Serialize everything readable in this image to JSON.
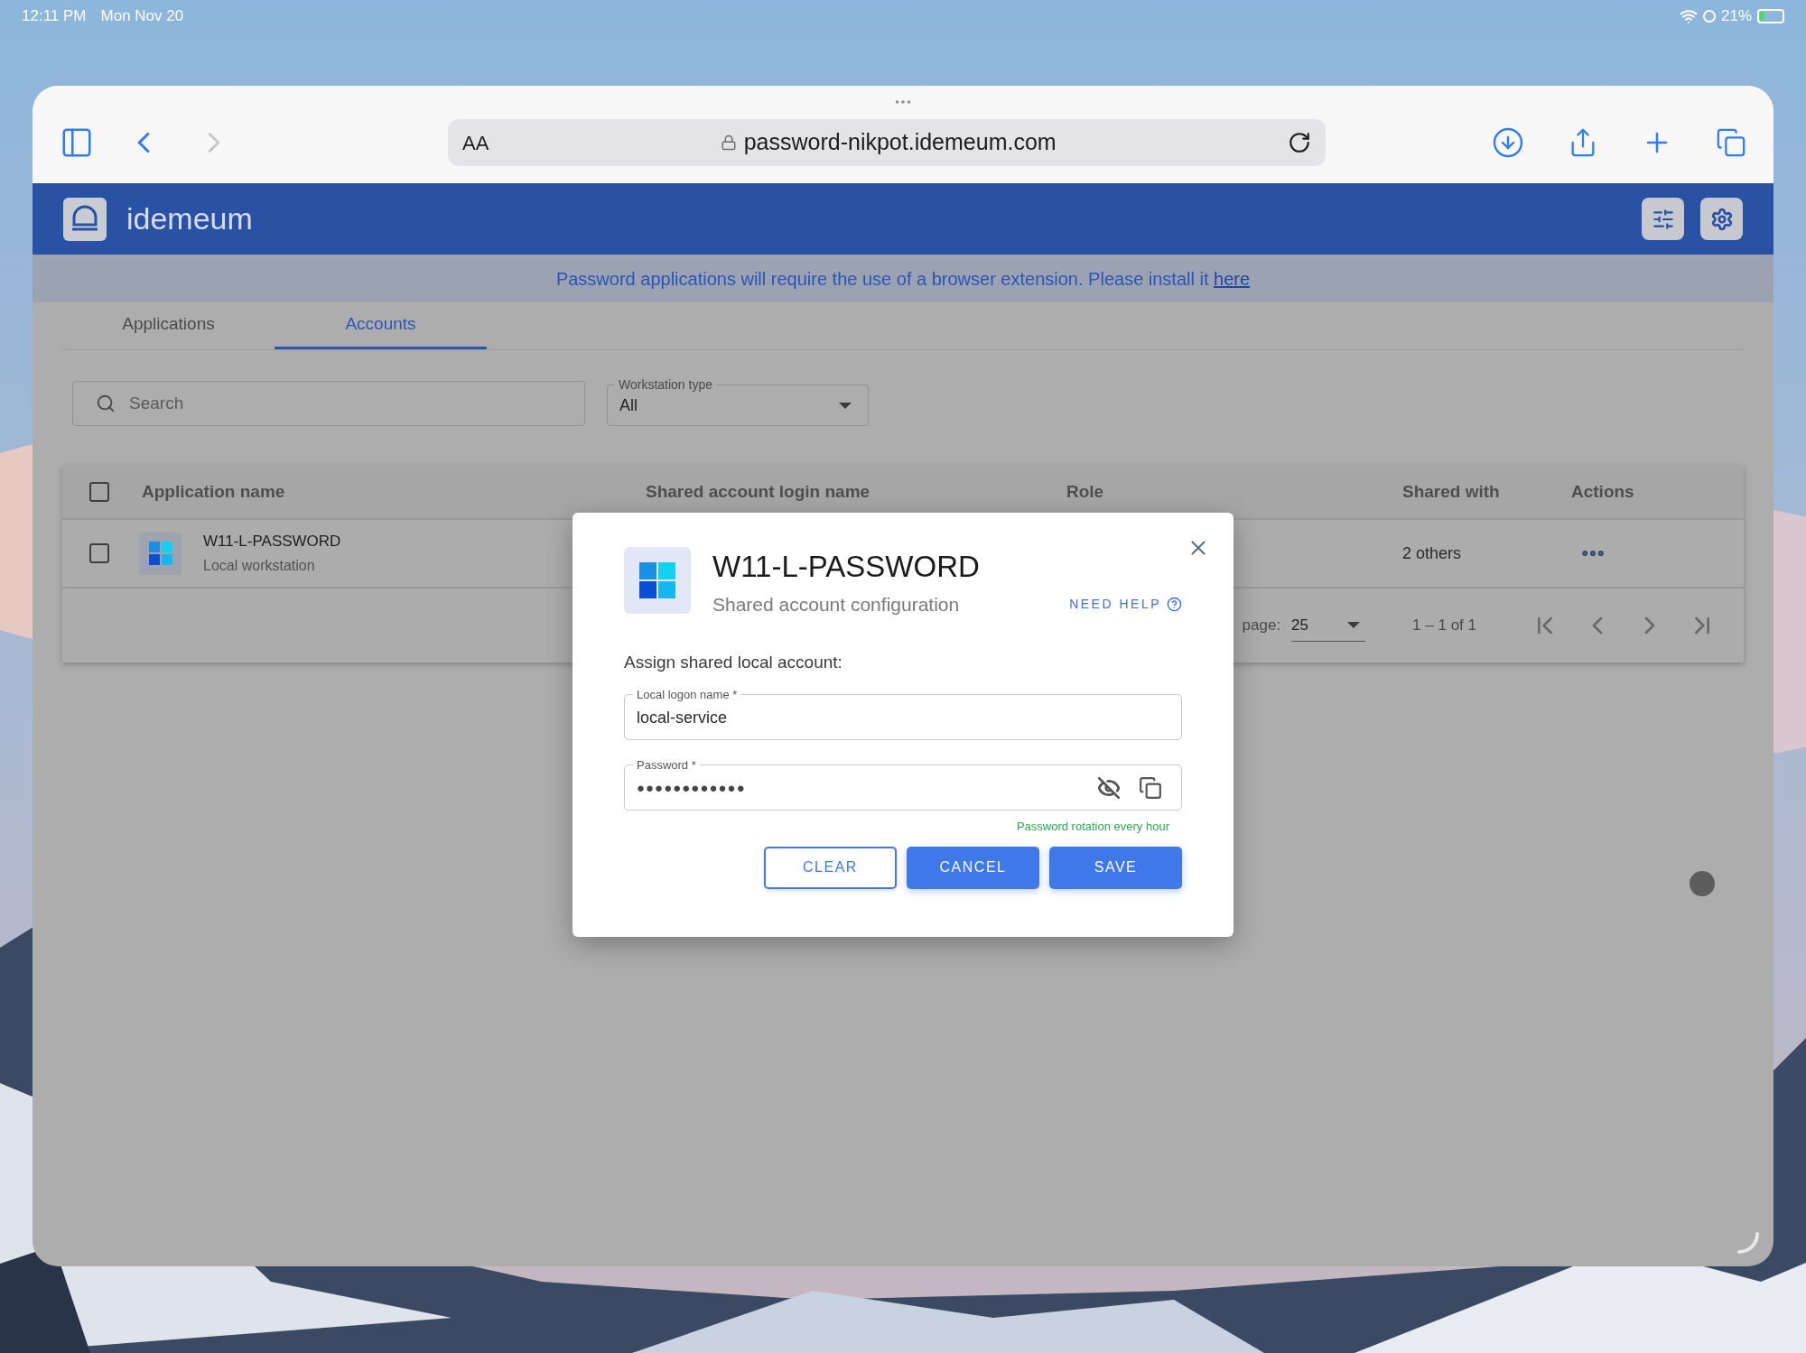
{
  "status_bar": {
    "time": "12:11 PM",
    "date": "Mon Nov 20",
    "battery": "21%"
  },
  "browser": {
    "text_size": "AA",
    "url": "password-nikpot.idemeum.com"
  },
  "app": {
    "brand": "idemeum",
    "banner": {
      "text": "Password applications will require the use of a browser extension. Please install it ",
      "link": "here"
    },
    "tabs": [
      {
        "label": "Applications",
        "selected": false
      },
      {
        "label": "Accounts",
        "selected": true
      }
    ],
    "search": {
      "placeholder": "Search"
    },
    "filter": {
      "label": "Workstation type",
      "value": "All"
    },
    "table": {
      "select_all_checked": false,
      "columns": [
        "Application name",
        "Shared account login name",
        "Role",
        "Shared with",
        "Actions"
      ],
      "rows": [
        {
          "checked": false,
          "name": "W11-L-PASSWORD",
          "subtitle": "Local workstation",
          "shared_with": "2 others"
        }
      ],
      "pagination": {
        "per_page_label": "page:",
        "per_page": "25",
        "range": "1 – 1 of 1"
      }
    }
  },
  "dialog": {
    "title": "W11-L-PASSWORD",
    "subtitle": "Shared account configuration",
    "help": "NEED HELP",
    "section": "Assign shared local account:",
    "fields": [
      {
        "kind": "text",
        "label": "Local logon name *",
        "value": "local-service"
      },
      {
        "kind": "password",
        "label": "Password *",
        "value": "●●●●●●●●●●●●"
      }
    ],
    "hint": "Password rotation every hour",
    "buttons": [
      {
        "label": "CLEAR",
        "kind": "outline"
      },
      {
        "label": "CANCEL",
        "kind": "filled"
      },
      {
        "label": "SAVE",
        "kind": "filled"
      }
    ]
  }
}
